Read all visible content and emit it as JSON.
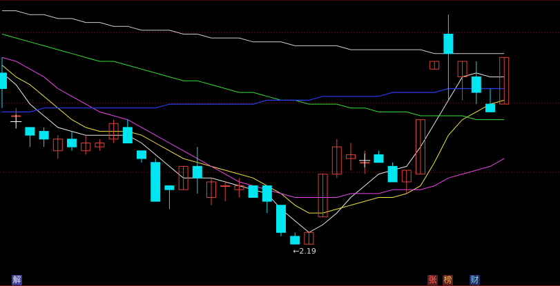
{
  "app": {
    "background": "#000000",
    "grid_color": "#7a1010",
    "up_color": "#e0413a",
    "down_color": "#00e5f0",
    "badges": [
      {
        "name": "jie-badge",
        "text": "解",
        "bg": "#3b3b9a",
        "fg": "#e8e8e8"
      },
      {
        "name": "zhang-badge",
        "text": "张",
        "bg": "#5a1f1f",
        "fg": "#ff6b5b"
      },
      {
        "name": "bang-badge",
        "text": "榜",
        "bg": "#5a1f1f",
        "fg": "#ffb347"
      },
      {
        "name": "cai-badge",
        "text": "财",
        "bg": "#1f2a5a",
        "fg": "#8fd3ff"
      }
    ]
  },
  "chart_data": {
    "type": "candlestick",
    "ylim": [
      2.1,
      2.8
    ],
    "grid_y": [
      2.734,
      2.553,
      2.375
    ],
    "low_annotation": {
      "text": "←2.19",
      "index": 21,
      "value": 2.19
    },
    "candles": [
      {
        "o": 2.63,
        "h": 2.67,
        "l": 2.54,
        "c": 2.59
      },
      {
        "o": 2.52,
        "h": 2.54,
        "l": 2.5,
        "c": 2.52
      },
      {
        "o": 2.49,
        "h": 2.49,
        "l": 2.44,
        "c": 2.47
      },
      {
        "o": 2.48,
        "h": 2.49,
        "l": 2.44,
        "c": 2.46
      },
      {
        "o": 2.43,
        "h": 2.47,
        "l": 2.41,
        "c": 2.46
      },
      {
        "o": 2.46,
        "h": 2.48,
        "l": 2.43,
        "c": 2.44
      },
      {
        "o": 2.43,
        "h": 2.47,
        "l": 2.42,
        "c": 2.45
      },
      {
        "o": 2.44,
        "h": 2.46,
        "l": 2.43,
        "c": 2.45
      },
      {
        "o": 2.46,
        "h": 2.51,
        "l": 2.45,
        "c": 2.5
      },
      {
        "o": 2.49,
        "h": 2.51,
        "l": 2.45,
        "c": 2.45
      },
      {
        "o": 2.43,
        "h": 2.43,
        "l": 2.4,
        "c": 2.41
      },
      {
        "o": 2.4,
        "h": 2.41,
        "l": 2.3,
        "c": 2.3
      },
      {
        "o": 2.34,
        "h": 2.34,
        "l": 2.28,
        "c": 2.33
      },
      {
        "o": 2.33,
        "h": 2.39,
        "l": 2.33,
        "c": 2.39
      },
      {
        "o": 2.39,
        "h": 2.44,
        "l": 2.32,
        "c": 2.36
      },
      {
        "o": 2.31,
        "h": 2.36,
        "l": 2.29,
        "c": 2.35
      },
      {
        "o": 2.34,
        "h": 2.35,
        "l": 2.3,
        "c": 2.34
      },
      {
        "o": 2.33,
        "h": 2.36,
        "l": 2.31,
        "c": 2.34
      },
      {
        "o": 2.34,
        "h": 2.34,
        "l": 2.31,
        "c": 2.31
      },
      {
        "o": 2.34,
        "h": 2.34,
        "l": 2.27,
        "c": 2.3
      },
      {
        "o": 2.29,
        "h": 2.29,
        "l": 2.21,
        "c": 2.22
      },
      {
        "o": 2.21,
        "h": 2.22,
        "l": 2.19,
        "c": 2.19
      },
      {
        "o": 2.19,
        "h": 2.22,
        "l": 2.19,
        "c": 2.22
      },
      {
        "o": 2.26,
        "h": 2.37,
        "l": 2.26,
        "c": 2.37
      },
      {
        "o": 2.37,
        "h": 2.46,
        "l": 2.36,
        "c": 2.44
      },
      {
        "o": 2.41,
        "h": 2.45,
        "l": 2.38,
        "c": 2.42
      },
      {
        "o": 2.4,
        "h": 2.43,
        "l": 2.37,
        "c": 2.4
      },
      {
        "o": 2.42,
        "h": 2.43,
        "l": 2.4,
        "c": 2.4
      },
      {
        "o": 2.39,
        "h": 2.4,
        "l": 2.35,
        "c": 2.35
      },
      {
        "o": 2.35,
        "h": 2.38,
        "l": 2.32,
        "c": 2.38
      },
      {
        "o": 2.37,
        "h": 2.51,
        "l": 2.37,
        "c": 2.51
      },
      {
        "o": 2.64,
        "h": 2.66,
        "l": 2.64,
        "c": 2.66
      },
      {
        "o": 2.73,
        "h": 2.78,
        "l": 2.56,
        "c": 2.68
      },
      {
        "o": 2.62,
        "h": 2.66,
        "l": 2.56,
        "c": 2.66
      },
      {
        "o": 2.62,
        "h": 2.66,
        "l": 2.55,
        "c": 2.58
      },
      {
        "o": 2.55,
        "h": 2.59,
        "l": 2.53,
        "c": 2.53
      },
      {
        "o": 2.55,
        "h": 2.67,
        "l": 2.55,
        "c": 2.67
      }
    ],
    "series": [
      {
        "color": "#e8e8e8",
        "width": 1.0,
        "values": [
          2.63,
          2.6,
          2.55,
          2.52,
          2.49,
          2.48,
          2.47,
          2.47,
          2.47,
          2.47,
          2.45,
          2.42,
          2.39,
          2.36,
          2.36,
          2.36,
          2.35,
          2.34,
          2.33,
          2.32,
          2.28,
          2.25,
          2.22,
          2.24,
          2.27,
          2.31,
          2.34,
          2.37,
          2.38,
          2.39,
          2.44,
          2.5,
          2.56,
          2.62,
          2.63,
          2.62,
          2.62
        ]
      },
      {
        "color": "#f2e63c",
        "width": 1.0,
        "values": [
          2.65,
          2.62,
          2.6,
          2.57,
          2.54,
          2.51,
          2.49,
          2.48,
          2.48,
          2.48,
          2.47,
          2.45,
          2.43,
          2.41,
          2.4,
          2.39,
          2.38,
          2.37,
          2.36,
          2.34,
          2.32,
          2.29,
          2.27,
          2.27,
          2.28,
          2.29,
          2.3,
          2.31,
          2.31,
          2.32,
          2.34,
          2.4,
          2.47,
          2.51,
          2.53,
          2.55,
          2.56
        ]
      },
      {
        "color": "#ef45ef",
        "width": 1.0,
        "values": [
          2.67,
          2.66,
          2.64,
          2.62,
          2.59,
          2.57,
          2.55,
          2.53,
          2.52,
          2.51,
          2.49,
          2.47,
          2.45,
          2.43,
          2.41,
          2.39,
          2.37,
          2.35,
          2.34,
          2.33,
          2.32,
          2.31,
          2.31,
          2.31,
          2.31,
          2.32,
          2.32,
          2.32,
          2.33,
          2.33,
          2.33,
          2.34,
          2.36,
          2.37,
          2.38,
          2.39,
          2.41
        ]
      },
      {
        "color": "#35e035",
        "width": 1.0,
        "values": [
          2.73,
          2.72,
          2.71,
          2.7,
          2.69,
          2.68,
          2.67,
          2.66,
          2.66,
          2.65,
          2.64,
          2.63,
          2.62,
          2.61,
          2.61,
          2.6,
          2.59,
          2.58,
          2.58,
          2.57,
          2.56,
          2.56,
          2.55,
          2.55,
          2.55,
          2.54,
          2.54,
          2.53,
          2.53,
          2.53,
          2.52,
          2.52,
          2.52,
          2.52,
          2.51,
          2.51,
          2.51
        ]
      },
      {
        "color": "#2a3cf0",
        "width": 1.2,
        "values": [
          2.53,
          2.53,
          2.53,
          2.54,
          2.54,
          2.54,
          2.54,
          2.54,
          2.54,
          2.54,
          2.54,
          2.54,
          2.55,
          2.55,
          2.55,
          2.55,
          2.55,
          2.55,
          2.55,
          2.56,
          2.56,
          2.56,
          2.56,
          2.57,
          2.57,
          2.57,
          2.57,
          2.57,
          2.58,
          2.58,
          2.58,
          2.58,
          2.59,
          2.59,
          2.59,
          2.59,
          2.59
        ]
      },
      {
        "color": "#d0d0d0",
        "width": 1.0,
        "values": [
          2.79,
          2.79,
          2.78,
          2.78,
          2.77,
          2.77,
          2.76,
          2.76,
          2.75,
          2.75,
          2.74,
          2.74,
          2.74,
          2.73,
          2.73,
          2.72,
          2.72,
          2.72,
          2.71,
          2.71,
          2.71,
          2.7,
          2.7,
          2.7,
          2.7,
          2.69,
          2.69,
          2.69,
          2.69,
          2.69,
          2.69,
          2.68,
          2.68,
          2.68,
          2.68,
          2.68,
          2.68
        ]
      }
    ],
    "cross_markers": [
      {
        "index": 1,
        "value": 2.505
      },
      {
        "index": 26,
        "value": 2.405
      }
    ]
  }
}
